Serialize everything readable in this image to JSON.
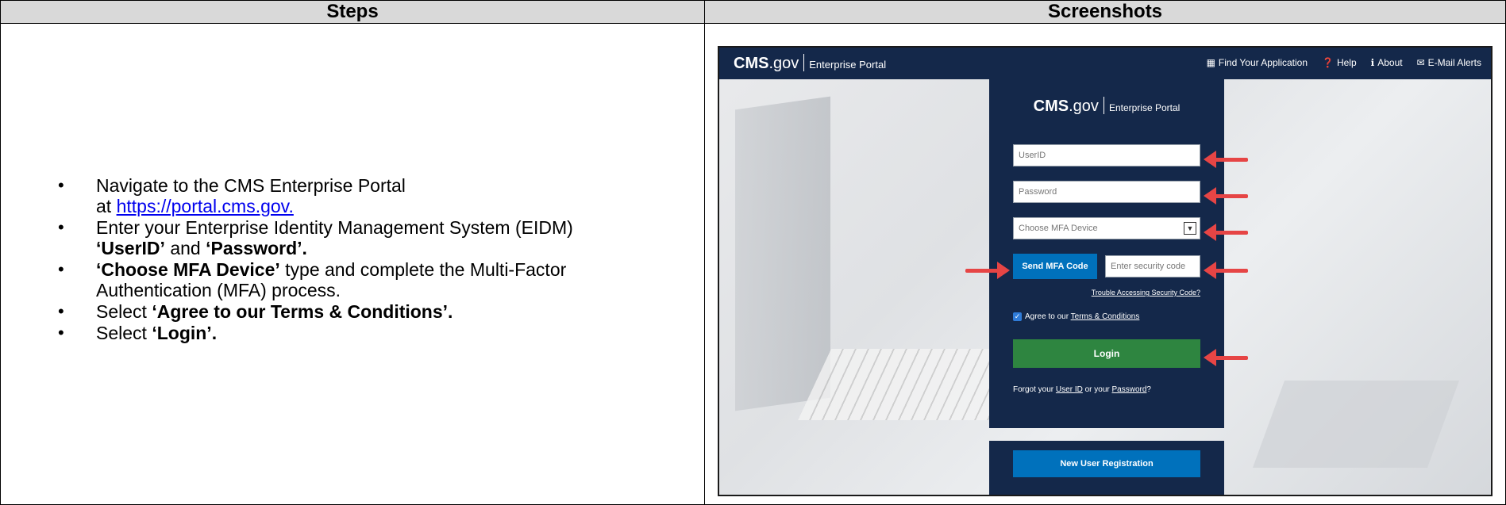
{
  "table": {
    "header_steps": "Steps",
    "header_screenshots": "Screenshots"
  },
  "steps": {
    "item1_text": "Navigate to the CMS Enterprise Portal",
    "item1_at": "at ",
    "item1_link": "https://portal.cms.gov.",
    "item2_pre": "Enter your Enterprise Identity Management System (EIDM)",
    "item2_userid": "‘UserID’",
    "item2_and": " and ",
    "item2_password": "‘Password’.",
    "item3_bold": "‘Choose MFA Device’",
    "item3_rest": " type and complete the Multi-Factor Authentication (MFA) process.",
    "item4_pre": "Select ",
    "item4_bold": "‘Agree to our Terms & Conditions’.",
    "item5_pre": "Select ",
    "item5_bold": "‘Login’."
  },
  "portal": {
    "brand_cms": "CMS",
    "brand_gov": ".gov",
    "brand_sub": "Enterprise Portal",
    "nav": [
      {
        "icon": "grid-icon",
        "glyph": "▦",
        "label": "Find Your Application"
      },
      {
        "icon": "help-icon",
        "glyph": "❓",
        "label": "Help"
      },
      {
        "icon": "info-icon",
        "glyph": "ℹ",
        "label": "About"
      },
      {
        "icon": "mail-icon",
        "glyph": "✉",
        "label": "E-Mail Alerts"
      }
    ],
    "userid_placeholder": "UserID",
    "password_placeholder": "Password",
    "mfa_select": "Choose MFA Device",
    "send_mfa_label": "Send MFA Code",
    "security_code_placeholder": "Enter security code",
    "trouble_link": "Trouble Accessing Security Code?",
    "agree_pre": "Agree to our ",
    "agree_link": "Terms & Conditions",
    "agree_checked": true,
    "login_label": "Login",
    "forgot_pre": "Forgot your ",
    "forgot_userid": "User ID",
    "forgot_or": " or your ",
    "forgot_password": "Password",
    "forgot_q": "?",
    "new_user_label": "New User Registration"
  },
  "colors": {
    "navy": "#14284a",
    "blue_button": "#0071bc",
    "green_button": "#2e8540",
    "arrow_red": "#e64545"
  }
}
